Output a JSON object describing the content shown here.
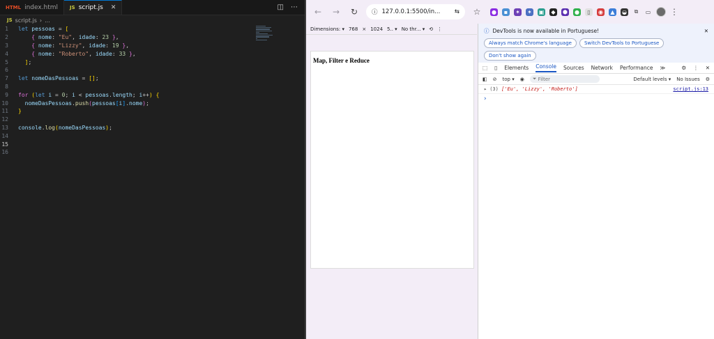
{
  "editor": {
    "tabs": [
      {
        "icon": "HTML",
        "label": "index.html"
      },
      {
        "icon": "JS",
        "label": "script.js"
      }
    ],
    "breadcrumb": [
      "script.js",
      "..."
    ],
    "lines": [
      {
        "n": "1",
        "c": "let pessoas = ["
      },
      {
        "n": "2",
        "c": "    { nome: \"Eu\", idade: 23 },"
      },
      {
        "n": "3",
        "c": "    { nome: \"Lizzy\", idade: 19 },"
      },
      {
        "n": "4",
        "c": "    { nome: \"Roberto\", idade: 33 },"
      },
      {
        "n": "5",
        "c": "  ];"
      },
      {
        "n": "6",
        "c": ""
      },
      {
        "n": "7",
        "c": "let nomeDasPessoas = [];"
      },
      {
        "n": "8",
        "c": ""
      },
      {
        "n": "9",
        "c": "for (let i = 0; i < pessoas.length; i++) {"
      },
      {
        "n": "10",
        "c": "  nomeDasPessoas.push(pessoas[i].nome);"
      },
      {
        "n": "11",
        "c": "}"
      },
      {
        "n": "12",
        "c": ""
      },
      {
        "n": "13",
        "c": "console.log(nomeDasPessoas);"
      },
      {
        "n": "14",
        "c": ""
      },
      {
        "n": "15",
        "c": ""
      },
      {
        "n": "16",
        "c": ""
      }
    ],
    "current_line": "15"
  },
  "browser": {
    "url": "127.0.0.1:5500/in...",
    "device_toolbar": {
      "dimensions": "Dimensions: ▾",
      "width": "768",
      "x": "×",
      "height": "1024",
      "zoom": "5.. ▾",
      "throttle": "No thr... ▾"
    },
    "page_heading": "Map, Filter e Reduce"
  },
  "devtools": {
    "notice": "DevTools is now available in Portuguese!",
    "notice_buttons": [
      "Always match Chrome's language",
      "Switch DevTools to Portuguese",
      "Don't show again"
    ],
    "tabs": [
      "Elements",
      "Console",
      "Sources",
      "Network",
      "Performance",
      "≫"
    ],
    "active_tab": "Console",
    "toolbar": {
      "context": "top ▾",
      "filter_placeholder": "Filter",
      "levels": "Default levels ▾",
      "issues": "No Issues"
    },
    "console_output": {
      "count": "(3)",
      "value": "['Eu', 'Lizzy', 'Roberto']",
      "source": "script.js:13"
    },
    "prompt": "›"
  }
}
